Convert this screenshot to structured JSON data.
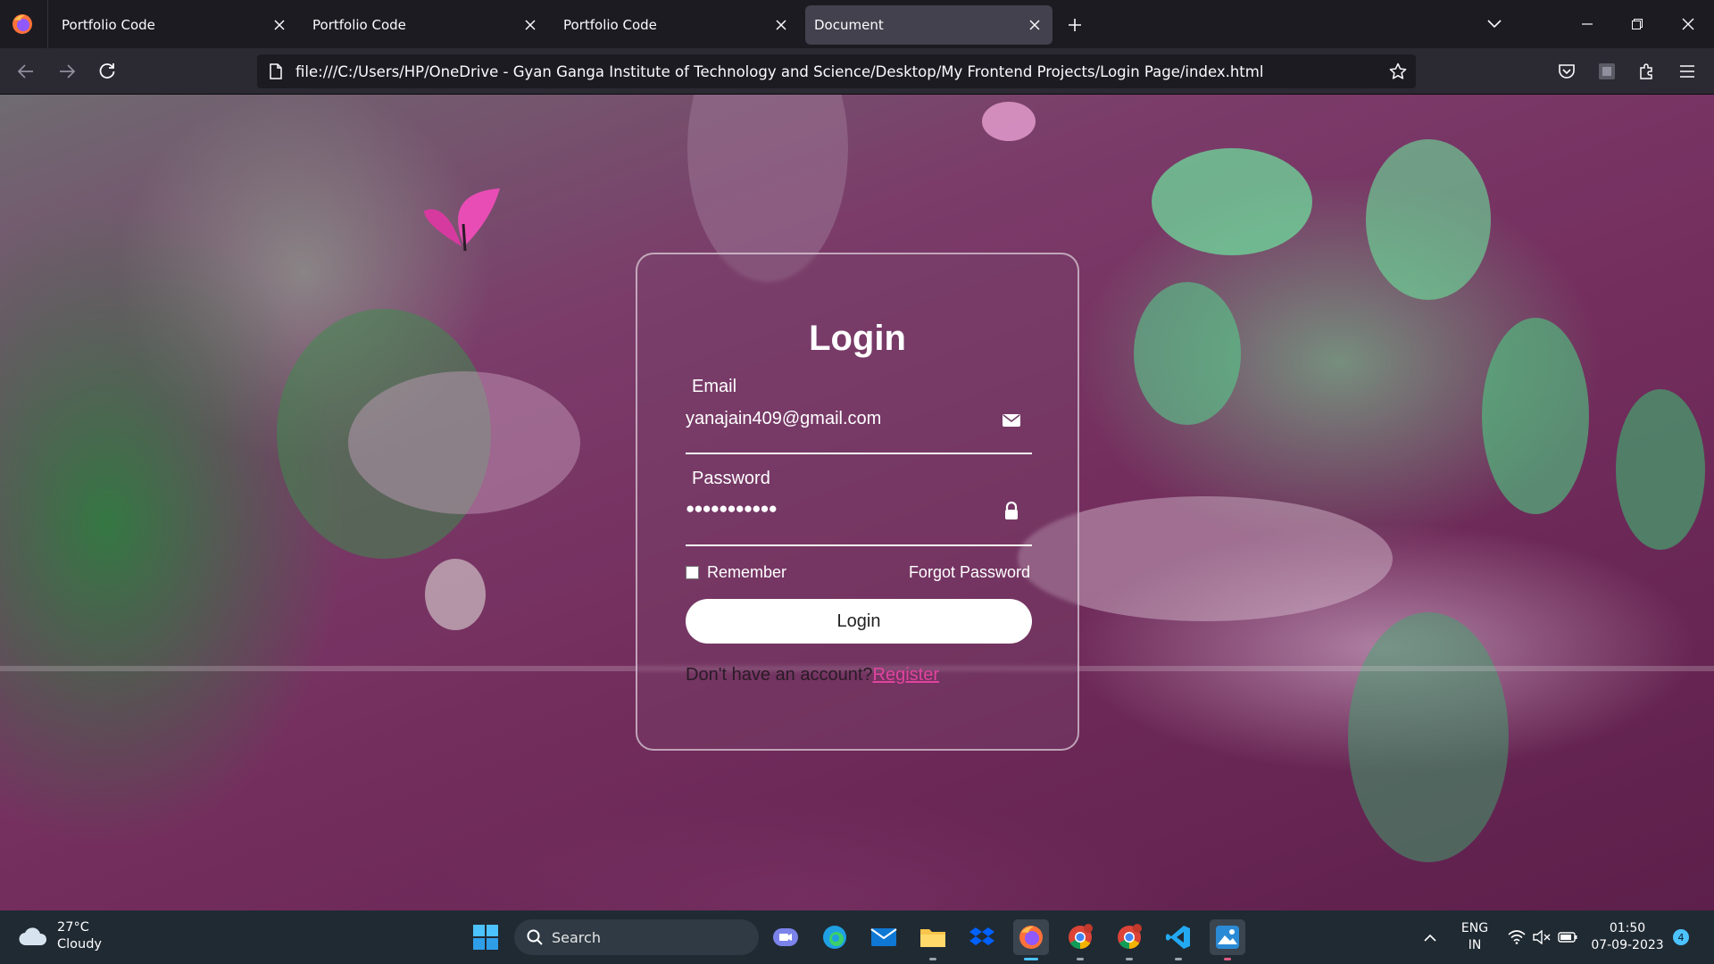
{
  "browser": {
    "tabs": [
      {
        "label": "Portfolio Code"
      },
      {
        "label": "Portfolio Code"
      },
      {
        "label": "Portfolio Code"
      },
      {
        "label": "Document"
      }
    ],
    "url": "file:///C:/Users/HP/OneDrive - Gyan Ganga Institute of Technology and Science/Desktop/My Frontend Projects/Login Page/index.html",
    "icons": [
      "firefox-icon",
      "close-icon",
      "plus-icon",
      "chevron-down-icon",
      "minimize-icon",
      "restore-icon",
      "back-icon",
      "forward-icon",
      "reload-icon",
      "page-icon",
      "star-icon",
      "pocket-icon",
      "extension-icon",
      "menu-icon"
    ]
  },
  "login": {
    "title": "Login",
    "email_label": "Email",
    "email_value": "yanajain409@gmail.com",
    "password_label": "Password",
    "password_value": "●●●●●●●●●●●",
    "remember_label": "Remember",
    "remember_checked": false,
    "forgot_label": "Forgot Password",
    "button_label": "Login",
    "no_account_text": "Don't have an account?",
    "register_label": "Register",
    "accent_color": "#e0449e"
  },
  "taskbar": {
    "weather_temp": "27°C",
    "weather_desc": "Cloudy",
    "search_label": "Search",
    "lang_top": "ENG",
    "lang_bottom": "IN",
    "time": "01:50",
    "date": "07-09-2023",
    "notification_count": "4"
  }
}
